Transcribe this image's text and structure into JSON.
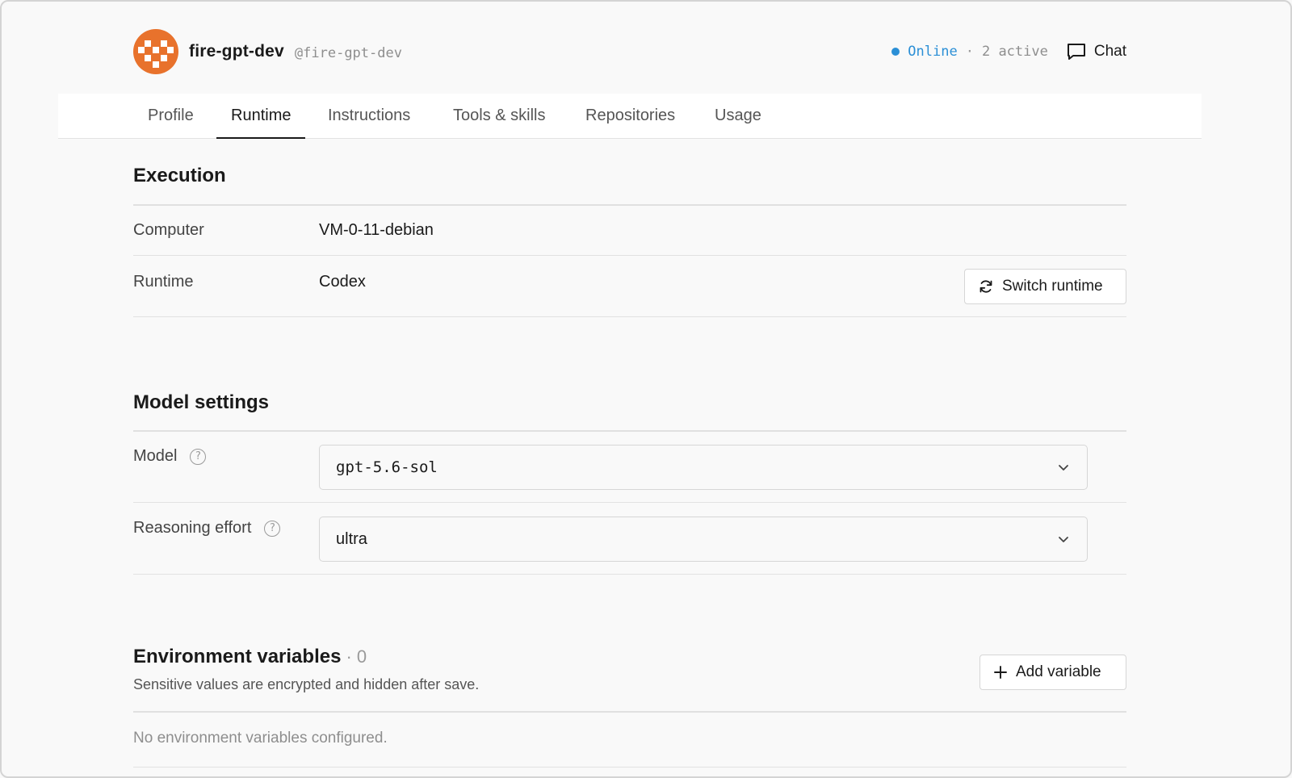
{
  "header": {
    "agent_name": "fire-gpt-dev",
    "agent_handle": "@fire-gpt-dev",
    "status": "Online",
    "active_separator": "·",
    "active_count": "2 active",
    "chat_label": "Chat",
    "status_color": "#2b8fd6",
    "avatar_color": "#e8722c"
  },
  "tabs": [
    {
      "label": "Profile",
      "active": false
    },
    {
      "label": "Runtime",
      "active": true
    },
    {
      "label": "Instructions",
      "active": false
    },
    {
      "label": "Tools & skills",
      "active": false
    },
    {
      "label": "Repositories",
      "active": false
    },
    {
      "label": "Usage",
      "active": false
    }
  ],
  "execution": {
    "title": "Execution",
    "computer_label": "Computer",
    "computer_value": "VM-0-11-debian",
    "runtime_label": "Runtime",
    "runtime_value": "Codex",
    "switch_button": "Switch runtime"
  },
  "model_settings": {
    "title": "Model settings",
    "model_label": "Model",
    "model_value": "gpt-5.6-sol",
    "effort_label": "Reasoning effort",
    "effort_value": "ultra",
    "help_glyph": "?"
  },
  "env": {
    "title": "Environment variables",
    "count": "· 0",
    "subtitle": "Sensitive values are encrypted and hidden after save.",
    "add_button": "Add variable",
    "empty": "No environment variables configured."
  },
  "icons": [
    "chat-icon",
    "refresh-icon",
    "help-icon",
    "chevron-down-icon",
    "plus-icon"
  ]
}
